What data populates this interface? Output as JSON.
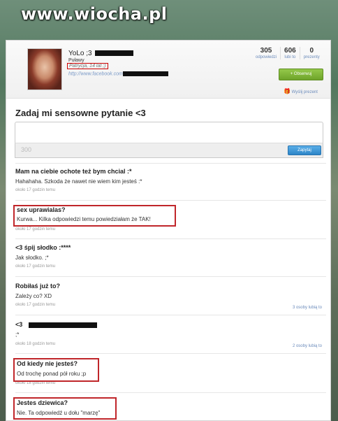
{
  "watermark": "www.wiocha.pl",
  "profile": {
    "name": "YoLo ;3",
    "city": "Puławy",
    "bio": "Patrycja, 14 lat ;)",
    "link": "http://www.facebook.com",
    "stats": [
      {
        "value": "305",
        "label": "odpowiedzi"
      },
      {
        "value": "606",
        "label": "lubi to"
      },
      {
        "value": "0",
        "label": "prezenty"
      }
    ],
    "follow_label": "+ Obserwuj",
    "gift_label": "Wyślij prezent"
  },
  "ask": {
    "title": "Zadaj mi sensowne pytanie <3",
    "counter": "300",
    "submit_label": "Zapytaj"
  },
  "answers": [
    {
      "question": "Mam na ciebie ochote też bym chcial :*",
      "answer": "Hahahaha. Szkoda że nawet nie wiem kim jesteś :*",
      "time": "około 17 godzin temu",
      "likes": ""
    },
    {
      "question": "sex uprawialas?",
      "answer": "Kurwa... Kilka odpowiedzi temu powiedziałam że TAK!",
      "time": "około 17 godzin temu",
      "likes": ""
    },
    {
      "question": "<3 śpij słodko :****",
      "answer": "Jak słodko. ;*",
      "time": "około 17 godzin temu",
      "likes": ""
    },
    {
      "question": "Robiłaś już to?",
      "answer": "Zależy co? XD",
      "time": "około 17 godzin temu",
      "likes": "3 osoby lubią to"
    },
    {
      "question": "<3",
      "answer": ";*",
      "time": "około 18 godzin temu",
      "likes": "2 osoby lubią to"
    },
    {
      "question": "Od kiedy nie jesteś?",
      "answer": "Od trochę ponad pół roku ;p",
      "time": "około 18 godzin temu",
      "likes": ""
    },
    {
      "question": "Jestes dziewica?",
      "answer": "Nie. Ta odpowiedź u dołu \"marzę\"",
      "time": "",
      "likes": ""
    }
  ],
  "colors": {
    "accent_green": "#6ea42a",
    "accent_blue": "#2d85c7",
    "highlight_red": "#c0262a"
  }
}
